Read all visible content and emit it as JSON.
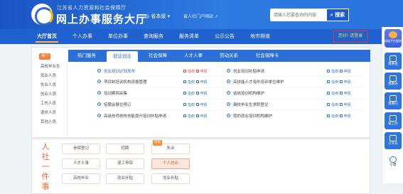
{
  "header": {
    "org": "江苏省人力资源和社会保障厅",
    "title": "网上办事服务大厅",
    "location": "省本级",
    "portal": "省人社门户网站",
    "search_placeholder": "请输入您要查询的内容",
    "search_button": "搜索"
  },
  "nav": {
    "items": [
      "大厅首页",
      "个人办事",
      "单位办事",
      "查询服务",
      "服务清单",
      "公示公告",
      "地市频道"
    ],
    "login": "您好! 请登录"
  },
  "categories": {
    "hot_label": "热门",
    "items": [
      "高校毕业生",
      "就业人员",
      "失业人员",
      "创业人员",
      "工伤人员",
      "退休人员",
      "其他人员"
    ]
  },
  "tabs": [
    "热门服务",
    "就业创业",
    "社会保障",
    "人才人事",
    "劳动关系",
    "社会保障卡"
  ],
  "active_tab": "就业创业",
  "services": {
    "left": [
      {
        "name": "创业培训计划发布",
        "actions": [
          "指南",
          "申报"
        ]
      },
      {
        "name": "项目制培训机构资格管理",
        "actions": [
          "指南",
          "申报"
        ]
      },
      {
        "name": "培训案例采集",
        "actions": [
          "指南",
          "申报"
        ]
      },
      {
        "name": "招聘会展位预订",
        "actions": [
          "指南",
          "申报"
        ]
      },
      {
        "name": "高级技师技校技能提升培训补贴申请",
        "actions": [
          "指南",
          "申报"
        ]
      }
    ],
    "right": [
      {
        "name": "创业培训补贴申请",
        "actions": [
          "指南",
          "申报"
        ]
      },
      {
        "name": "高技能人才海外培训单位维护",
        "actions": [
          "指南",
          "申报"
        ]
      },
      {
        "name": "谈岗培训机构维护",
        "actions": [
          "指南",
          "申报"
        ]
      },
      {
        "name": "离校毕业生求职登记",
        "actions": [
          "指南",
          "申报"
        ]
      },
      {
        "name": "我的就业培训机构维护",
        "actions": [
          "指南",
          "申报"
        ]
      }
    ]
  },
  "life_events": {
    "heading_chars": [
      "人",
      "社",
      "一",
      "件",
      "事"
    ],
    "chips": [
      [
        "参保登记",
        "招聘",
        "失业"
      ],
      [
        "人才人事",
        "退工停保",
        "个人创业"
      ],
      [
        "高校毕业",
        "就业补贴",
        "创业补贴"
      ]
    ],
    "tag": "新版",
    "highlighted": "个人创业"
  },
  "toolbar": {
    "top": "省级平台服务",
    "items": [
      "我要查",
      "我要办",
      "我要问",
      "掌上办",
      "公众号",
      "小慧"
    ]
  },
  "colors": {
    "primary": "#2c6fd9",
    "accent_orange": "#ef6a2d",
    "action_red": "#e15547",
    "highlight_box": "#e03a30"
  }
}
